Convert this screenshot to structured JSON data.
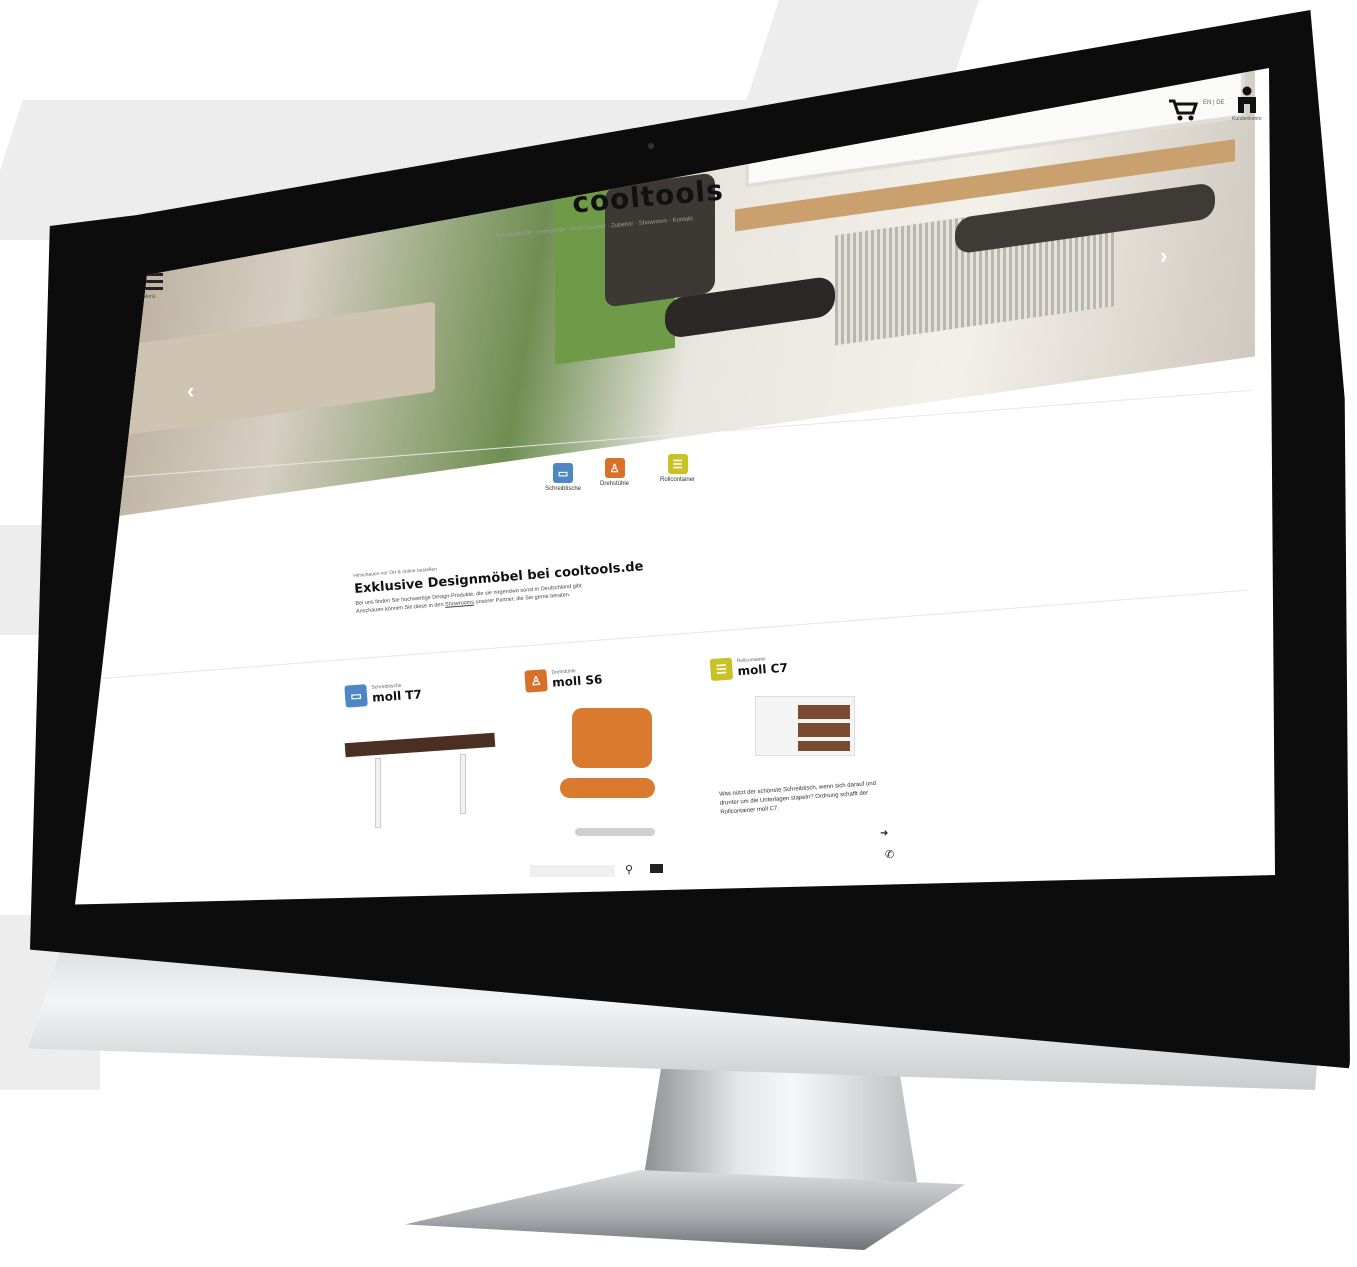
{
  "site": {
    "logo": "cooltools",
    "nav_strip": "Schreibtische · Drehstühle · Rollcontainer · Zubehör · Showroom · Kontakt",
    "menu_label": "Menü",
    "lang": "EN | DE",
    "account_label": "Kundenkonto"
  },
  "hero": {
    "prev_arrow": "‹",
    "next_arrow": "›"
  },
  "categories": [
    {
      "label": "Schreibtische",
      "color": "#4f86c6",
      "icon": "desk-icon"
    },
    {
      "label": "Drehstühle",
      "color": "#d9702a",
      "icon": "chair-icon"
    },
    {
      "label": "Rollcontainer",
      "color": "#c8c227",
      "icon": "container-icon"
    }
  ],
  "intro": {
    "kicker": "Hinschauen vor Ort & online bestellen",
    "title": "Exklusive Designmöbel bei cooltools.de",
    "text1": "Bei uns finden Sie hochwertige Design-Produkte, die sie nirgendwo sonst in Deutschland gibt.",
    "text2_pre": "Anschauen können Sie diese in den",
    "text2_link": "Showrooms",
    "text2_post": "unserer Partner, die Sie gerne beraten."
  },
  "products": [
    {
      "category": "Schreibtische",
      "name": "moll T7",
      "color": "#4f86c6",
      "icon": "desk-icon"
    },
    {
      "category": "Drehstühle",
      "name": "moll S6",
      "color": "#d9702a",
      "icon": "chair-icon"
    },
    {
      "category": "Rollcontainer",
      "name": "moll C7",
      "color": "#c8c227",
      "icon": "container-icon",
      "text": "Was nützt der schönste Schreibtisch, wenn sich darauf und drunter um die Unterlagen stapeln? Ordnung schafft der Rollcontainer moll C7."
    }
  ],
  "footer": {
    "search_icon": "search-icon",
    "mail_icon": "mail-icon",
    "phone_icon": "phone-icon"
  }
}
